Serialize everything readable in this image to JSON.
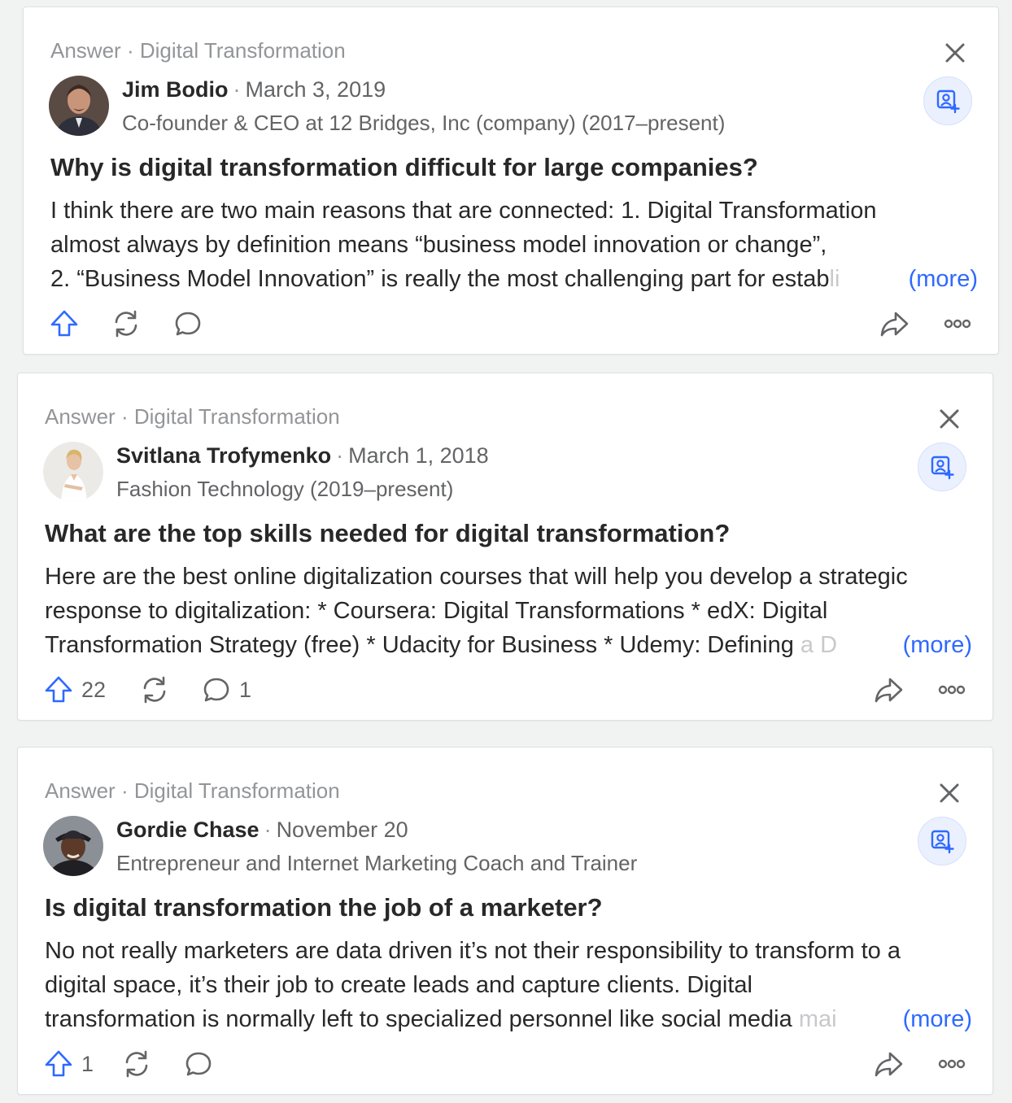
{
  "colors": {
    "accent": "#2e69ff",
    "text_primary": "#282829",
    "text_secondary": "#636466",
    "text_muted": "#939598",
    "follow_bg": "#ebf0ff"
  },
  "icons": {
    "upvote": "arrow-up-icon",
    "share_rewind": "refresh-icon",
    "comment": "speech-bubble-icon",
    "share": "share-arrow-icon",
    "overflow": "more-dots-icon",
    "close": "close-icon",
    "follow": "person-plus-icon"
  },
  "cards": [
    {
      "type_label": "Answer",
      "separator": "·",
      "topic": "Digital Transformation",
      "author": "Jim Bodio",
      "date": "March 3, 2019",
      "credential": "Co-founder & CEO at 12 Bridges, Inc (company) (2017–present)",
      "question": "Why is digital transformation difficult for large companies?",
      "body_lines": [
        "I think there are two main reasons that are connected: 1. Digital Transformation",
        "almost always by definition means “business model innovation or change”,",
        "2. “Business Model Innovation” is really the most challenging part for estab"
      ],
      "body_fade": "li",
      "more_label": "(more)",
      "upvotes": "",
      "comments": ""
    },
    {
      "type_label": "Answer",
      "separator": "·",
      "topic": "Digital Transformation",
      "author": "Svitlana Trofymenko",
      "date": "March 1, 2018",
      "credential": "Fashion Technology (2019–present)",
      "question": "What are the top skills needed for digital transformation?",
      "body_lines": [
        "Here are the best online digitalization courses that will help you develop a strategic",
        "response to digitalization: * Coursera: Digital Transformations * edX: Digital",
        "Transformation Strategy (free) * Udacity for Business * Udemy: Defining "
      ],
      "body_fade": "a D",
      "more_label": "(more)",
      "upvotes": "22",
      "comments": "1"
    },
    {
      "type_label": "Answer",
      "separator": "·",
      "topic": "Digital Transformation",
      "author": "Gordie Chase",
      "date": "November 20",
      "credential": "Entrepreneur and Internet Marketing Coach and Trainer",
      "question": "Is digital transformation the job of a marketer?",
      "body_lines": [
        "No not really marketers are data driven it’s not their responsibility to transform to a",
        "digital space, it’s their job to create leads and capture clients. Digital",
        "transformation is normally left to specialized personnel like social media "
      ],
      "body_fade": "mai",
      "more_label": "(more)",
      "upvotes": "1",
      "comments": ""
    }
  ]
}
